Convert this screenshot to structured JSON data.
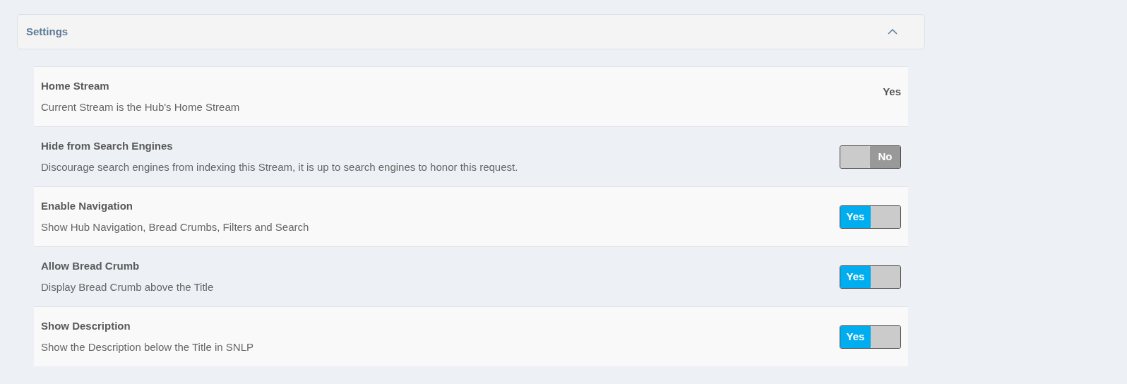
{
  "panel": {
    "title": "Settings",
    "expanded": true
  },
  "settings": [
    {
      "kind": "value",
      "label": "Home Stream",
      "description": "Current Stream is the Hub's Home Stream",
      "value": "Yes"
    },
    {
      "kind": "toggle",
      "label": "Hide from Search Engines",
      "description": "Discourage search engines from indexing this Stream, it is up to search engines to honor this request.",
      "on": false,
      "value": "No"
    },
    {
      "kind": "toggle",
      "label": "Enable Navigation",
      "description": "Show Hub Navigation, Bread Crumbs, Filters and Search",
      "on": true,
      "value": "Yes"
    },
    {
      "kind": "toggle",
      "label": "Allow Bread Crumb",
      "description": "Display Bread Crumb above the Title",
      "on": true,
      "value": "Yes"
    },
    {
      "kind": "toggle",
      "label": "Show Description",
      "description": "Show the Description below the Title in SNLP",
      "on": true,
      "value": "Yes"
    }
  ]
}
